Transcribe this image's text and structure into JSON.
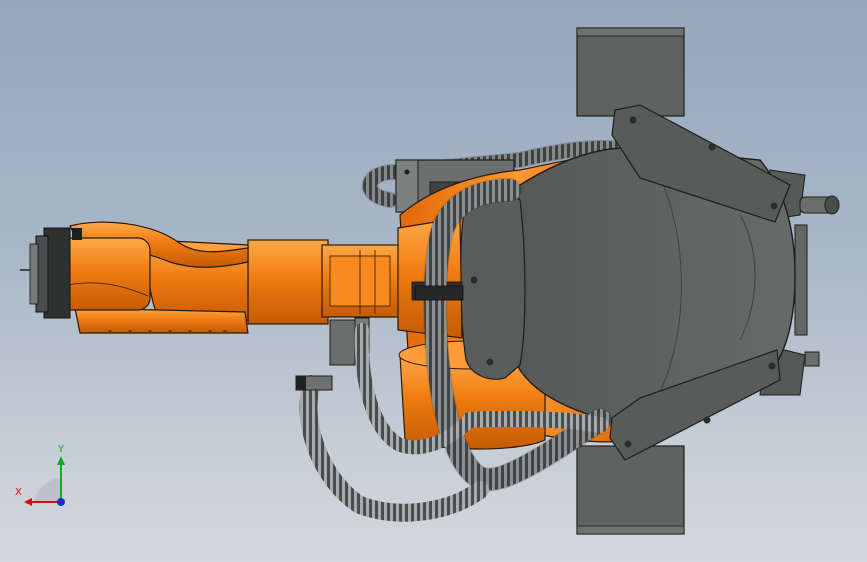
{
  "viewport": {
    "background_top": "#96a7bc",
    "background_bottom": "#d3d8dd"
  },
  "model": {
    "description_icon": "industrial-robot-arm-icon",
    "colors": {
      "robot_orange": "#f07d12",
      "robot_orange_dark": "#c85e06",
      "robot_orange_light": "#ffa040",
      "base_gray": "#5c5f5e",
      "base_gray_dark": "#3e4140",
      "cable_dark": "#2f3131",
      "cable_light": "#9ea3a3"
    }
  },
  "triad": {
    "x_label": "X",
    "y_label": "Y",
    "x_color": "#cc1111",
    "y_color": "#11aa22",
    "z_color": "#1133cc"
  }
}
